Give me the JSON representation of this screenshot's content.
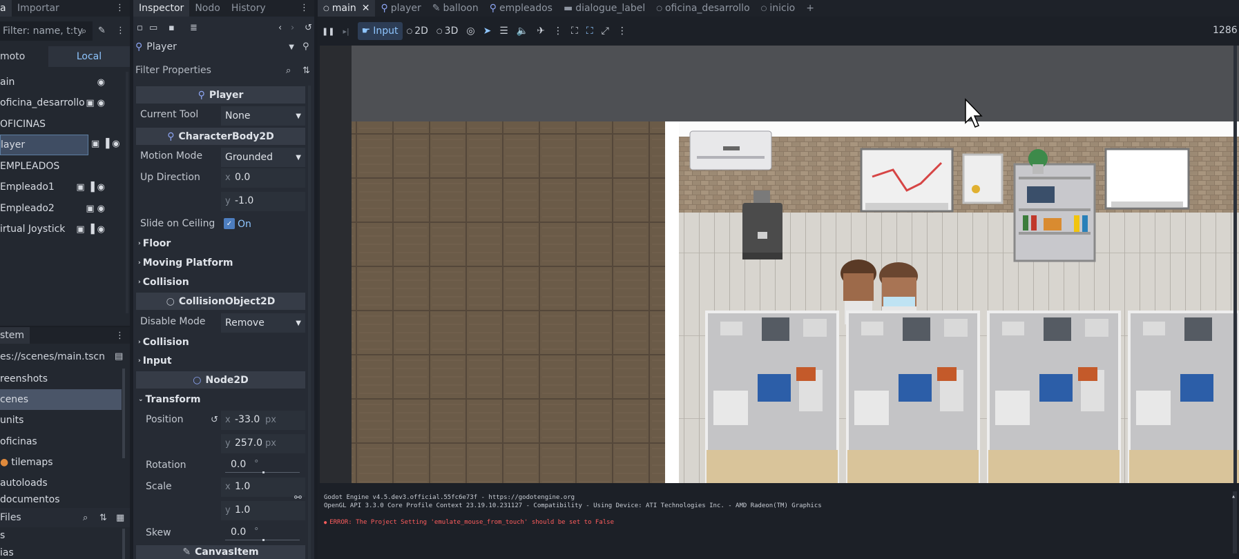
{
  "scene_dock": {
    "tabs": [
      "a",
      "Importar"
    ],
    "filter_placeholder": "Filter: name, t:ty",
    "remote_tab": "moto",
    "local_tab": "Local",
    "tree": [
      {
        "label": "ain"
      },
      {
        "label": "oficina_desarrollo"
      },
      {
        "label": "OFICINAS"
      },
      {
        "label": "layer"
      },
      {
        "label": "EMPLEADOS"
      },
      {
        "label": "Empleado1"
      },
      {
        "label": "Empleado2"
      },
      {
        "label": "irtual Joystick"
      }
    ]
  },
  "fs_dock": {
    "title": "stem",
    "path": "es://scenes/main.tscn",
    "items": [
      {
        "label": "reenshots"
      },
      {
        "label": "cenes"
      },
      {
        "label": "units"
      },
      {
        "label": "oficinas"
      },
      {
        "label": "tilemaps"
      },
      {
        "label": "autoloads"
      },
      {
        "label": "documentos"
      }
    ],
    "files_label": "Files",
    "bottom_items": [
      "s",
      "ias"
    ]
  },
  "inspector": {
    "tabs": [
      "Inspector",
      "Nodo",
      "History"
    ],
    "node_name": "Player",
    "filter_placeholder": "Filter Properties",
    "sections": {
      "player": "Player",
      "characterbody2d": "CharacterBody2D",
      "collisionobject2d": "CollisionObject2D",
      "node2d": "Node2D",
      "canvasitem": "CanvasItem"
    },
    "props": {
      "current_tool": {
        "label": "Current Tool",
        "value": "None"
      },
      "motion_mode": {
        "label": "Motion Mode",
        "value": "Grounded"
      },
      "up_direction": {
        "label": "Up Direction",
        "x": "0.0",
        "y": "-1.0"
      },
      "slide_on_ceiling": {
        "label": "Slide on Ceiling",
        "value": "On"
      },
      "disable_mode": {
        "label": "Disable Mode",
        "value": "Remove"
      },
      "position": {
        "label": "Position",
        "x": "-33.0",
        "y": "257.0",
        "unit": "px"
      },
      "rotation": {
        "label": "Rotation",
        "value": "0.0",
        "unit": "°"
      },
      "scale": {
        "label": "Scale",
        "x": "1.0",
        "y": "1.0"
      },
      "skew": {
        "label": "Skew",
        "value": "0.0",
        "unit": "°"
      }
    },
    "groups": [
      "Floor",
      "Moving Platform",
      "Collision",
      "Collision",
      "Input",
      "Transform"
    ]
  },
  "editor": {
    "scene_tabs": [
      "main",
      "player",
      "balloon",
      "empleados",
      "dialogue_label",
      "oficina_desarrollo",
      "inicio"
    ],
    "toolbar": {
      "input": "Input",
      "two_d": "2D",
      "three_d": "3D",
      "resolution": "1286"
    }
  },
  "output": {
    "lines": [
      "Godot Engine v4.5.dev3.official.55fc6e73f - https://godotengine.org",
      "OpenGL API 3.3.0 Core Profile Context 23.19.10.231127 - Compatibility - Using Device: ATI Technologies Inc. - AMD Radeon(TM) Graphics"
    ],
    "error": "ERROR: The Project Setting 'emulate_mouse_from_touch' should be set to False"
  },
  "axis_labels": {
    "x": "x",
    "y": "y"
  },
  "colors": {
    "accent": "#8fc6ff",
    "error": "#ff5d5d",
    "panel": "#262b34"
  }
}
